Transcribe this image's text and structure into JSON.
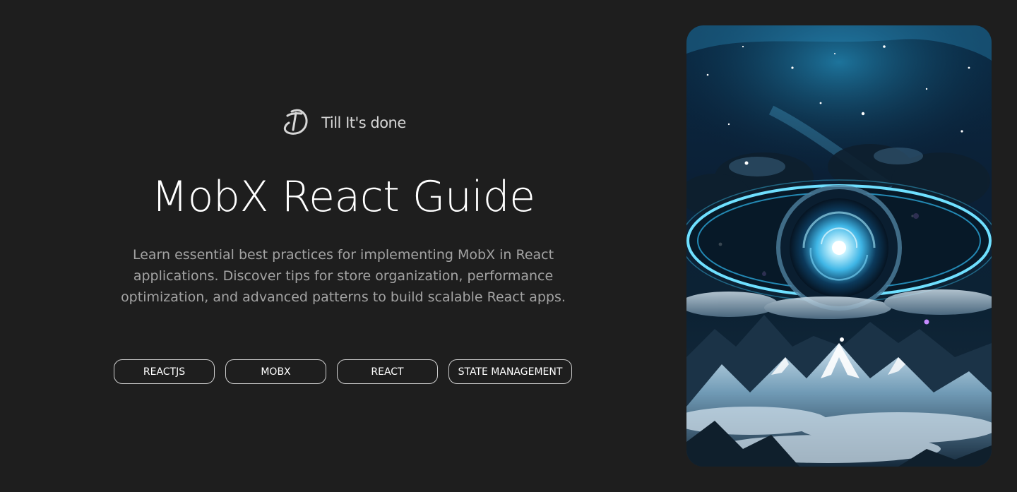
{
  "brand": {
    "logo_icon": "td-monogram-icon",
    "name": "Till It's done"
  },
  "article": {
    "title": "MobX React Guide",
    "description": "Learn essential best practices for implementing MobX in React applications. Discover tips for store organization, performance optimization, and advanced patterns to build scalable React apps.",
    "tags": [
      "REACTJS",
      "MOBX",
      "REACT",
      "STATE MANAGEMENT"
    ]
  },
  "hero_image": {
    "subject": "cosmic-eye-galaxy-over-mountains-image"
  },
  "colors": {
    "background": "#1e1e1e",
    "title": "#ffffff",
    "description": "#a3a3a3",
    "tag_border": "#cfcfcf",
    "accent_cyan": "#3fd0ff"
  }
}
